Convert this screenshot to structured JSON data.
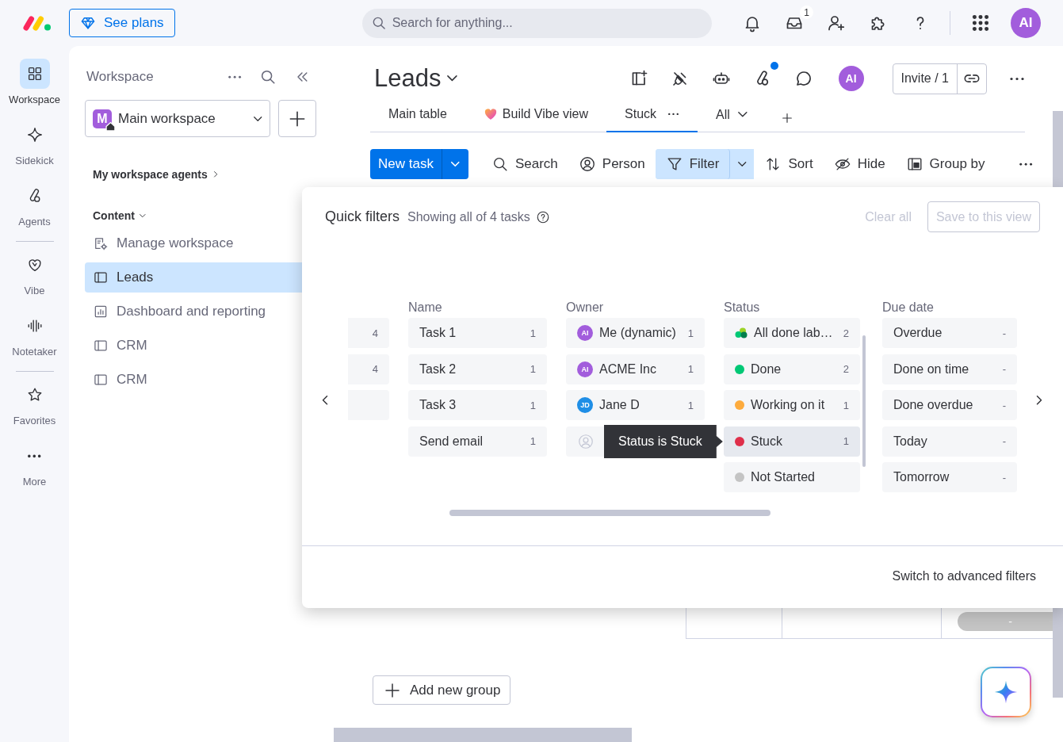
{
  "topbar": {
    "upgrade_button": "See plans",
    "search": {
      "placeholder": "Search for anything..."
    },
    "inbox_badge": "1",
    "avatar": "AI"
  },
  "rail": {
    "groups": [
      {
        "items": [
          {
            "kind": "grid",
            "label": "Workspace",
            "selected": true
          },
          {
            "kind": "sparkle",
            "label": "Sidekick",
            "selected": false
          },
          {
            "kind": "agent",
            "label": "Agents",
            "selected": false
          }
        ]
      },
      {
        "items": [
          {
            "kind": "heart",
            "label": "Vibe",
            "selected": false
          },
          {
            "kind": "wave",
            "label": "Notetaker",
            "selected": false
          }
        ]
      },
      {
        "items": [
          {
            "kind": "star",
            "label": "Favorites",
            "selected": false
          },
          {
            "kind": "more",
            "label": "More",
            "selected": false
          }
        ]
      }
    ]
  },
  "workspace_panel": {
    "title": "Workspace",
    "selector": {
      "badge": "M",
      "name": "Main workspace"
    },
    "agents_link": "My workspace agents",
    "section": {
      "label": "Content",
      "expanded": true
    },
    "items": [
      {
        "kind": "settings",
        "label": "Manage workspace",
        "selected": false
      },
      {
        "kind": "board",
        "label": "Leads",
        "selected": true
      },
      {
        "kind": "dashboard",
        "label": "Dashboard and reporting",
        "selected": false
      },
      {
        "kind": "board",
        "label": "CRM",
        "selected": false
      },
      {
        "kind": "board",
        "label": "CRM",
        "selected": false
      }
    ]
  },
  "board": {
    "title": "Leads",
    "agents_notification": true,
    "avatar": "AI",
    "invite_button": "Invite / 1",
    "views": [
      {
        "kind": "plain",
        "label": "Main table",
        "selected": false
      },
      {
        "kind": "vibe",
        "label": "Build Vibe view",
        "selected": false
      },
      {
        "kind": "plain",
        "label": "Stuck",
        "selected": true
      }
    ],
    "view_dropdown": "All",
    "new_task_button": "New task",
    "toolbar": [
      {
        "kind": "search",
        "label": "Search",
        "active": false
      },
      {
        "kind": "person",
        "label": "Person",
        "active": false
      },
      {
        "kind": "filter",
        "label": "Filter",
        "active": true
      },
      {
        "kind": "sort",
        "label": "Sort",
        "active": false
      },
      {
        "kind": "hide",
        "label": "Hide",
        "active": false
      },
      {
        "kind": "group",
        "label": "Group by",
        "active": false
      }
    ],
    "table_fragment": {
      "date_value": "-"
    },
    "add_group_button": "Add new group"
  },
  "quick_filters": {
    "title": "Quick filters",
    "summary": "Showing all of 4 tasks",
    "clear": {
      "label": "Clear all",
      "disabled": true
    },
    "save": {
      "label": "Save to this view",
      "disabled": true
    },
    "columns": [
      {
        "kind": "partial",
        "items": [
          {
            "kind": "count",
            "count": "4"
          },
          {
            "kind": "count",
            "count": "4"
          },
          {
            "kind": "blank"
          }
        ]
      },
      {
        "kind": "text",
        "title": "Name",
        "items": [
          {
            "label": "Task 1",
            "count": "1"
          },
          {
            "label": "Task 2",
            "count": "1"
          },
          {
            "label": "Task 3",
            "count": "1"
          },
          {
            "label": "Send email",
            "count": "1"
          }
        ]
      },
      {
        "kind": "person",
        "title": "Owner",
        "items": [
          {
            "kind": "avatar",
            "initials": "AI",
            "color": "#a25ddc",
            "label": "Me (dynamic)",
            "count": "1"
          },
          {
            "kind": "avatar",
            "initials": "AI",
            "color": "#a25ddc",
            "label": "ACME Inc",
            "count": "1"
          },
          {
            "kind": "avatar",
            "initials": "JD",
            "color": "#1f8ee6",
            "label": "Jane D",
            "count": "1"
          },
          {
            "kind": "placeholder"
          }
        ]
      },
      {
        "kind": "status",
        "title": "Status",
        "items": [
          {
            "kind": "group",
            "label": "All done lab…",
            "count": "2",
            "hovered": false
          },
          {
            "kind": "dot",
            "color": "#00c875",
            "label": "Done",
            "count": "2",
            "hovered": false
          },
          {
            "kind": "dot",
            "color": "#fdab3d",
            "label": "Working on it",
            "count": "1",
            "hovered": false
          },
          {
            "kind": "dot",
            "color": "#df2f4a",
            "label": "Stuck",
            "count": "1",
            "hovered": true
          },
          {
            "kind": "dot",
            "color": "#c4c4c4",
            "label": "Not Started",
            "hovered": false
          }
        ]
      },
      {
        "kind": "text",
        "title": "Due date",
        "items": [
          {
            "label": "Overdue",
            "count": "-"
          },
          {
            "label": "Done on time",
            "count": "-"
          },
          {
            "label": "Done overdue",
            "count": "-"
          },
          {
            "label": "Today",
            "count": "-"
          },
          {
            "label": "Tomorrow",
            "count": "-"
          }
        ]
      }
    ],
    "tooltip": "Status is Stuck",
    "footer_link": "Switch to advanced filters"
  }
}
